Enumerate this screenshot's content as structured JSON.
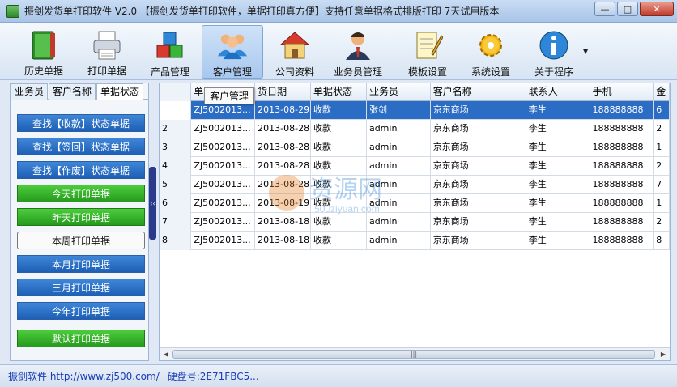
{
  "window": {
    "title": "振剑发货单打印软件 V2.0 【振剑发货单打印软件，单据打印真方便】支持任意单据格式排版打印 7天试用版本",
    "minimize": "—",
    "maximize": "□",
    "close": "✕"
  },
  "toolbar": {
    "items": [
      {
        "label": "历史单据",
        "icon": "book-icon"
      },
      {
        "label": "打印单据",
        "icon": "printer-icon"
      },
      {
        "label": "产品管理",
        "icon": "cubes-icon"
      },
      {
        "label": "客户管理",
        "icon": "users-icon"
      },
      {
        "label": "公司资料",
        "icon": "house-icon"
      },
      {
        "label": "业务员管理",
        "icon": "person-icon"
      },
      {
        "label": "模板设置",
        "icon": "notepad-icon"
      },
      {
        "label": "系统设置",
        "icon": "gear-icon"
      },
      {
        "label": "关于程序",
        "icon": "info-icon"
      }
    ],
    "active_index": 3,
    "more_caret": "▼"
  },
  "left": {
    "tabs": [
      "业务员",
      "客户名称",
      "单据状态"
    ],
    "active_tab": 2,
    "buttons": [
      {
        "label": "查找【收款】状态单据",
        "style": "blue"
      },
      {
        "label": "查找【签回】状态单据",
        "style": "blue"
      },
      {
        "label": "查找【作废】状态单据",
        "style": "blue"
      },
      {
        "label": "今天打印单据",
        "style": "green"
      },
      {
        "label": "昨天打印单据",
        "style": "green"
      },
      {
        "label": "本周打印单据",
        "style": "white"
      },
      {
        "label": "本月打印单据",
        "style": "blue"
      },
      {
        "label": "三月打印单据",
        "style": "blue"
      },
      {
        "label": "今年打印单据",
        "style": "blue"
      },
      {
        "label": "默认打印单据",
        "style": "green"
      }
    ],
    "splitter_glyph": "‹‹"
  },
  "grid": {
    "columns": [
      "",
      "单",
      "货日期",
      "单据状态",
      "业务员",
      "客户名称",
      "联系人",
      "手机",
      "金"
    ],
    "rows": [
      [
        "",
        "ZJ5002013...",
        "2013-08-29",
        "收款",
        "张剑",
        "京东商场",
        "李生",
        "188888888",
        "6"
      ],
      [
        "2",
        "ZJ5002013...",
        "2013-08-28",
        "收款",
        "admin",
        "京东商场",
        "李生",
        "188888888",
        "2"
      ],
      [
        "3",
        "ZJ5002013...",
        "2013-08-28",
        "收款",
        "admin",
        "京东商场",
        "李生",
        "188888888",
        "1"
      ],
      [
        "4",
        "ZJ5002013...",
        "2013-08-28",
        "收款",
        "admin",
        "京东商场",
        "李生",
        "188888888",
        "2"
      ],
      [
        "5",
        "ZJ5002013...",
        "2013-08-28",
        "收款",
        "admin",
        "京东商场",
        "李生",
        "188888888",
        "7"
      ],
      [
        "6",
        "ZJ5002013...",
        "2013-08-19",
        "收款",
        "admin",
        "京东商场",
        "李生",
        "188888888",
        "1"
      ],
      [
        "7",
        "ZJ5002013...",
        "2013-08-18",
        "收款",
        "admin",
        "京东商场",
        "李生",
        "188888888",
        "2"
      ],
      [
        "8",
        "ZJ5002013...",
        "2013-08-18",
        "收款",
        "admin",
        "京东商场",
        "李生",
        "188888888",
        "8"
      ]
    ],
    "selected_row": 0,
    "tooltip": "客户管理",
    "scroll_left": "◀",
    "scroll_right": "▶",
    "scroll_grip": "|||"
  },
  "status": {
    "link": "振剑软件 http://www.zj500.com/",
    "disk": "硬盘号:2E71FBC5..."
  },
  "watermark": {
    "brand": "资源网",
    "url": "500ziyuan.com"
  }
}
